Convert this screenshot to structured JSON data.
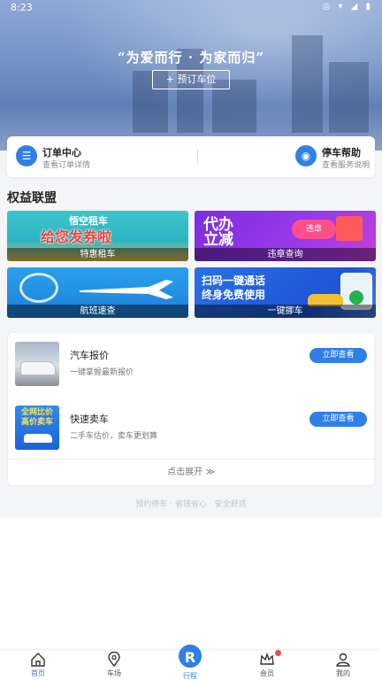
{
  "status": {
    "time": "8:23",
    "icons": "◎ ▾ ◢ ▮"
  },
  "hero": {
    "slogan": "“为爱而行 · 为家而归”",
    "reserve_label": "+ 预订车位"
  },
  "quick": [
    {
      "title": "订单中心",
      "subtitle": "查看订单详情",
      "icon": "list-icon",
      "glyph": "☰"
    },
    {
      "title": "停车帮助",
      "subtitle": "查看服务说明",
      "icon": "help-icon",
      "glyph": "◉"
    }
  ],
  "section": {
    "title": "权益联盟"
  },
  "tiles": [
    {
      "label": "特惠租车",
      "banner_top": "悟空租车",
      "banner_main": "给您发券啦"
    },
    {
      "label": "违章查询",
      "banner_main": "代办立减",
      "banner_tag": "违章"
    },
    {
      "label": "航班速查"
    },
    {
      "label": "一键挪车",
      "banner_main": "扫码一键通话",
      "banner_sub": "终身免费使用"
    }
  ],
  "products": [
    {
      "title": "汽车报价",
      "subtitle": "一键掌握最新报价",
      "button": "立即查看",
      "image": "car-photo"
    },
    {
      "title": "快速卖车",
      "subtitle": "二手车估价，卖车更划算",
      "button": "立即查看",
      "image": "sell-car-banner",
      "image_text": "全网比价 高价卖车"
    }
  ],
  "expand_label": "点击展开 ≫",
  "footer": "预约停车 · 省钱省心 · 安全舒适",
  "tabbar": [
    {
      "label": "首页",
      "icon": "home-icon"
    },
    {
      "label": "车场",
      "icon": "location-icon"
    },
    {
      "label": "行程",
      "icon": "trip-icon",
      "glyph": "R"
    },
    {
      "label": "会员",
      "icon": "crown-icon"
    },
    {
      "label": "我的",
      "icon": "profile-icon"
    }
  ],
  "colors": {
    "accent": "#2f7fe8",
    "badge": "#f04b4b"
  }
}
